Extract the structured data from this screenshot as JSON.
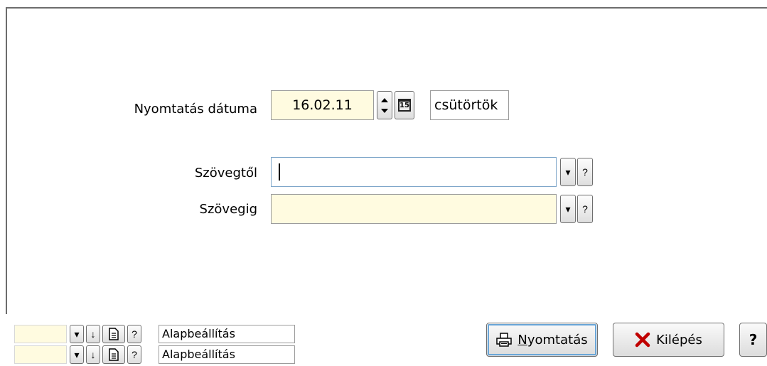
{
  "form": {
    "print_date_label": "Nyomtatás dátuma",
    "print_date_value": "16.02.11",
    "weekday_value": "csütörtök",
    "text_from_label": "Szövegtől",
    "text_from_value": "",
    "text_to_label": "Szövegig",
    "text_to_value": ""
  },
  "settings_rows": [
    {
      "name": "Alapbeállítás"
    },
    {
      "name": "Alapbeállítás"
    }
  ],
  "buttons": {
    "print_label_u": "N",
    "print_label_rest": "yomtatás",
    "exit_label": "Kilépés",
    "help_label": "?"
  },
  "glyphs": {
    "dropdown": "▾",
    "help": "?",
    "down_arrow": "↓",
    "calendar_day": "15"
  },
  "colors": {
    "field_yellow": "#fffbe0",
    "exit_icon": "#c00000",
    "focus_outline": "#6aa6d8"
  }
}
